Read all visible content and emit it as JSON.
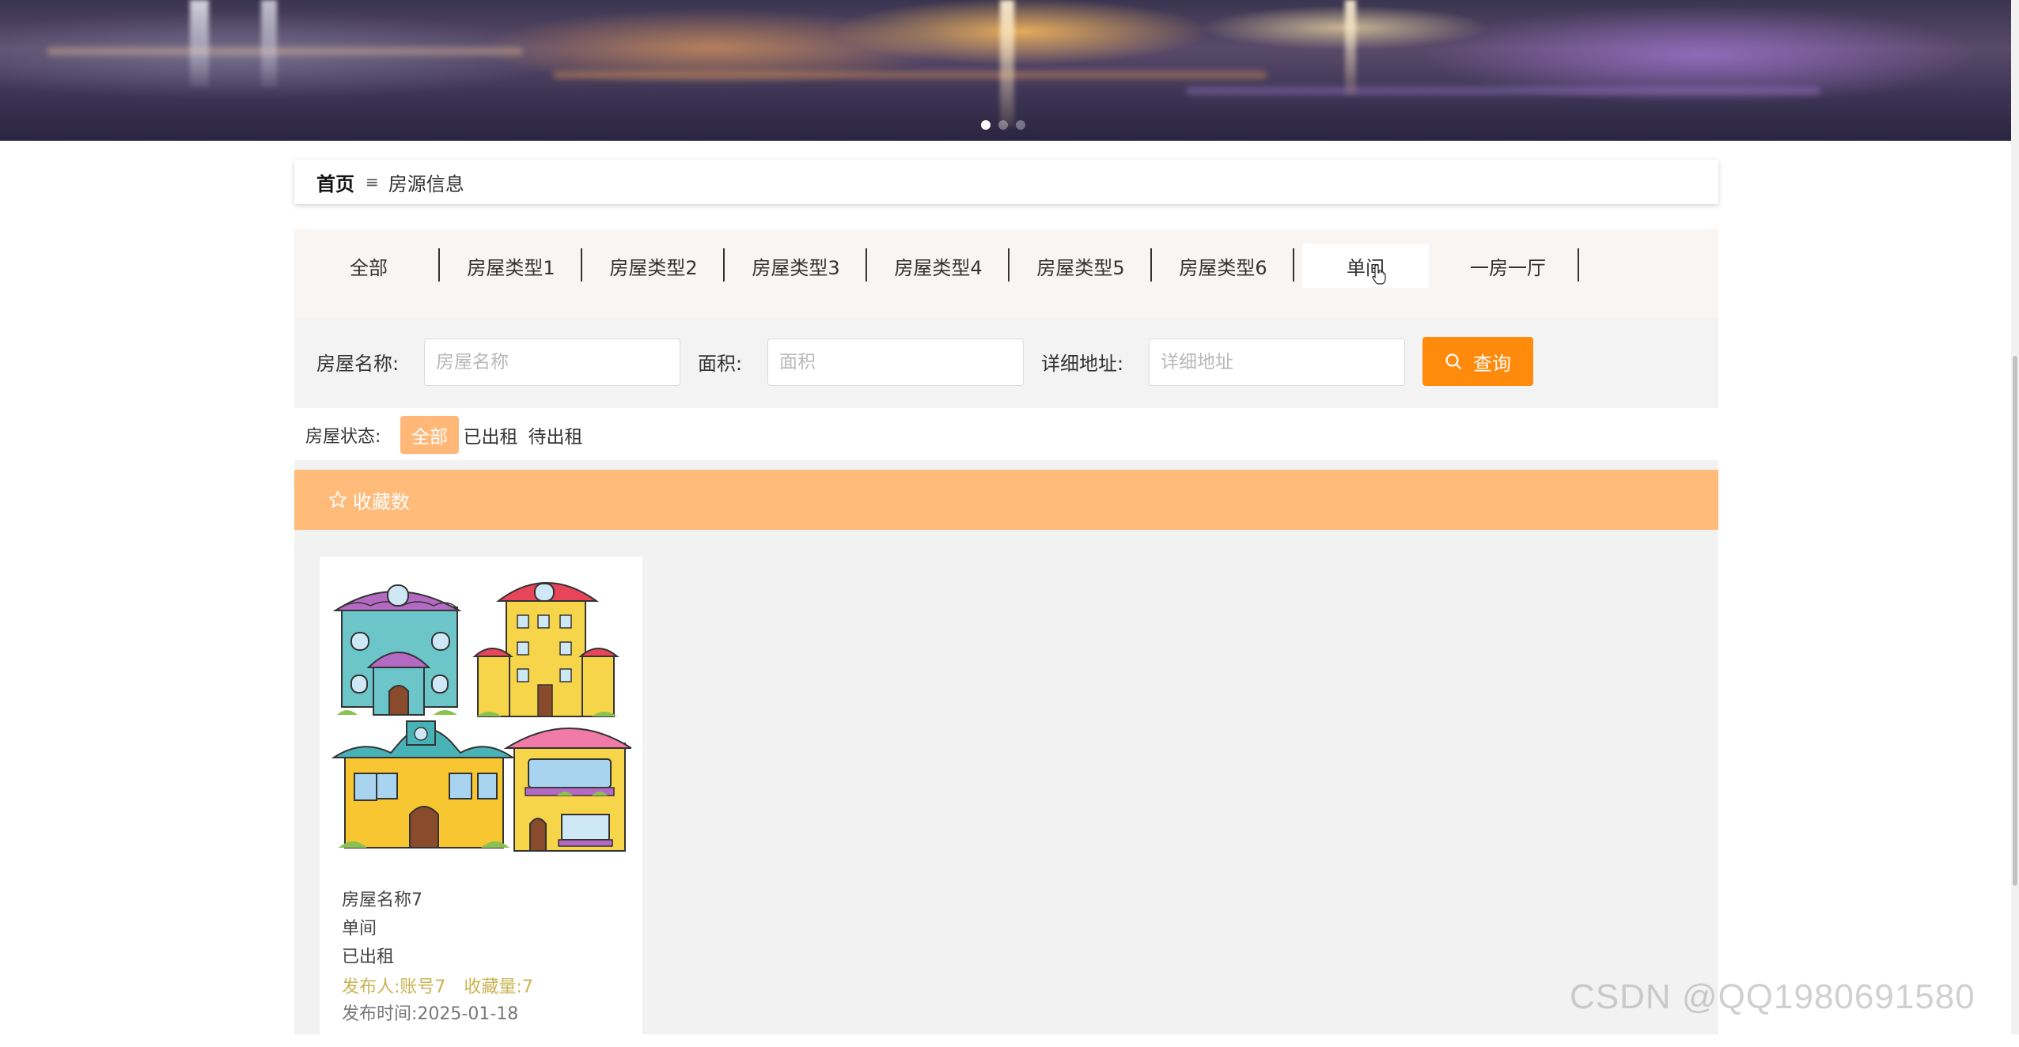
{
  "carousel": {
    "slide_count": 3,
    "active_index": 0
  },
  "breadcrumb": {
    "home": "首页",
    "separator": "≡",
    "current": "房源信息"
  },
  "category_tabs": {
    "items": [
      "全部",
      "房屋类型1",
      "房屋类型2",
      "房屋类型3",
      "房屋类型4",
      "房屋类型5",
      "房屋类型6",
      "单间",
      "一房一厅"
    ],
    "active_index": 7
  },
  "search": {
    "name_label": "房屋名称:",
    "name_placeholder": "房屋名称",
    "area_label": "面积:",
    "area_placeholder": "面积",
    "address_label": "详细地址:",
    "address_placeholder": "详细地址",
    "button_label": "查询",
    "button_color": "#ff8a0c"
  },
  "status_filter": {
    "label": "房屋状态:",
    "options": [
      "全部",
      "已出租",
      "待出租"
    ],
    "active_index": 0,
    "active_color": "#ffb878"
  },
  "sort_bar": {
    "icon": "star-outline-icon",
    "label": "收藏数",
    "color": "#ffbb7a"
  },
  "listings": [
    {
      "name": "房屋名称7",
      "type": "单间",
      "status": "已出租",
      "publisher_label": "发布人:",
      "publisher": "账号7",
      "favorites_label": "收藏量:",
      "favorites": "7",
      "time_label": "发布时间:",
      "time": "2025-01-18",
      "image": "cartoon-houses-illustration"
    }
  ],
  "watermark": "CSDN @QQ1980691580"
}
